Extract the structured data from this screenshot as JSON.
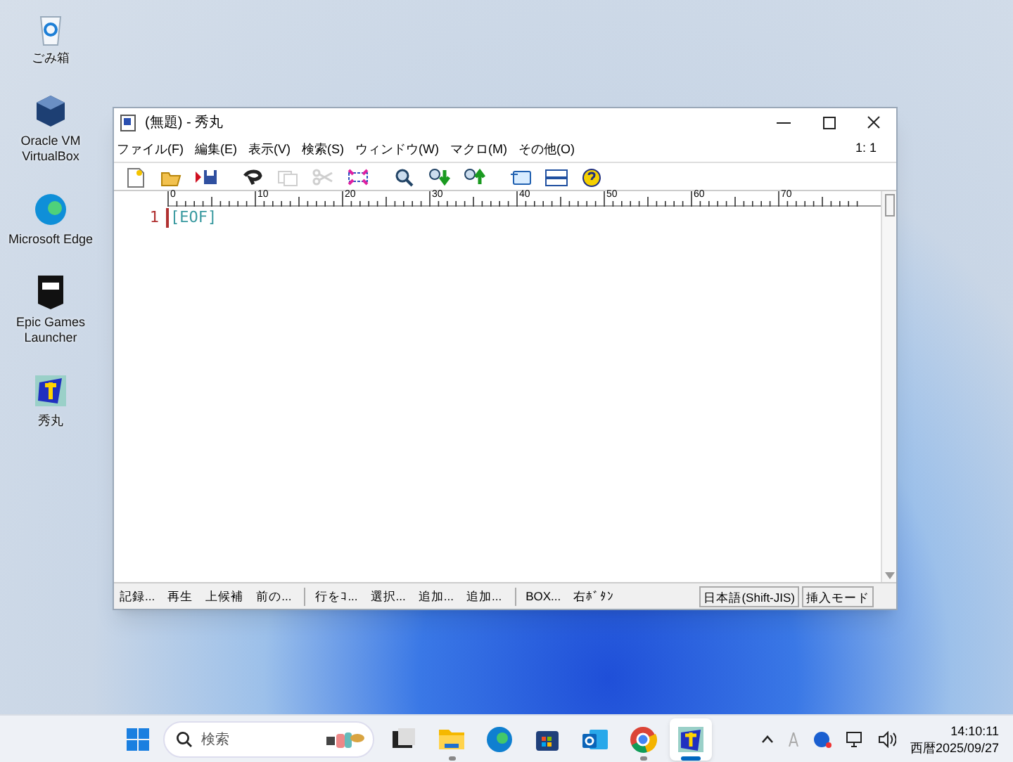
{
  "desktop_icons": [
    {
      "kind": "recycle",
      "label": "ごみ箱"
    },
    {
      "kind": "virtualbox",
      "label": "Oracle VM VirtualBox"
    },
    {
      "kind": "edge",
      "label": "Microsoft Edge"
    },
    {
      "kind": "epic",
      "label": "Epic Games Launcher"
    },
    {
      "kind": "hidemaru",
      "label": "秀丸"
    }
  ],
  "window": {
    "title": "(無題) - 秀丸",
    "menu": [
      "ファイル(F)",
      "編集(E)",
      "表示(V)",
      "検索(S)",
      "ウィンドウ(W)",
      "マクロ(M)",
      "その他(O)"
    ],
    "cursor_position": "1: 1",
    "toolbar": [
      {
        "kind": "new",
        "disabled": false
      },
      {
        "kind": "open",
        "disabled": false
      },
      {
        "kind": "save",
        "disabled": false
      },
      {
        "kind": "undo",
        "disabled": false
      },
      {
        "kind": "copy",
        "disabled": true
      },
      {
        "kind": "cut",
        "disabled": true
      },
      {
        "kind": "paste",
        "disabled": false
      },
      {
        "kind": "find",
        "disabled": false
      },
      {
        "kind": "find-next",
        "disabled": false
      },
      {
        "kind": "find-prev",
        "disabled": false
      },
      {
        "kind": "jump",
        "disabled": false
      },
      {
        "kind": "split",
        "disabled": false
      },
      {
        "kind": "help",
        "disabled": false
      }
    ],
    "ruler": [
      "0",
      "10",
      "20",
      "30",
      "40",
      "50",
      "60",
      "70"
    ],
    "line_number": "1",
    "eof": "[EOF]",
    "status_items": [
      {
        "label": "記録...",
        "divider_before": false
      },
      {
        "label": "再生",
        "divider_before": false
      },
      {
        "label": "上候補",
        "divider_before": false
      },
      {
        "label": "前の...",
        "divider_before": false
      },
      {
        "label": "行をｺ...",
        "divider_before": true
      },
      {
        "label": "選択...",
        "divider_before": false
      },
      {
        "label": "追加...",
        "divider_before": false
      },
      {
        "label": "追加...",
        "divider_before": false
      },
      {
        "label": "BOX...",
        "divider_before": true
      },
      {
        "label": "右ﾎﾞﾀﾝ",
        "divider_before": false
      }
    ],
    "encoding": "日本語(Shift-JIS)",
    "mode": "挿入モード"
  },
  "taskbar": {
    "search_placeholder": "検索",
    "apps": [
      {
        "kind": "taskview",
        "running": false,
        "selected": false
      },
      {
        "kind": "explorer",
        "running": true,
        "selected": false
      },
      {
        "kind": "edge",
        "running": false,
        "selected": false
      },
      {
        "kind": "store",
        "running": false,
        "selected": false
      },
      {
        "kind": "outlook",
        "running": false,
        "selected": false
      },
      {
        "kind": "chrome",
        "running": true,
        "selected": false
      },
      {
        "kind": "hidemaru",
        "running": true,
        "selected": true
      }
    ],
    "time": "14:10:11",
    "date": "西暦2025/09/27"
  }
}
